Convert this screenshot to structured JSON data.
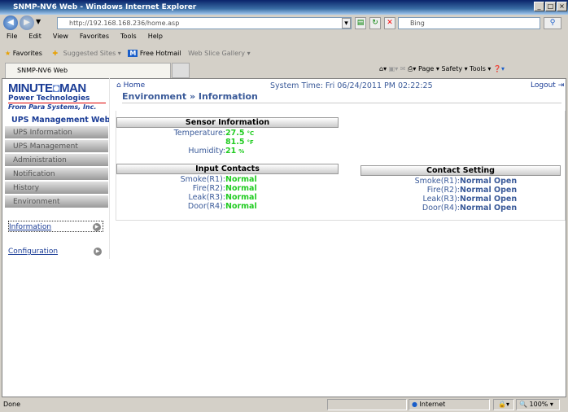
{
  "window": {
    "title": "SNMP-NV6 Web - Windows Internet Explorer"
  },
  "browser": {
    "address": "http://192.168.168.236/home.asp",
    "search_placeholder": "Bing",
    "menu": [
      "File",
      "Edit",
      "View",
      "Favorites",
      "Tools",
      "Help"
    ],
    "favorites_label": "Favorites",
    "fav_links": [
      "Suggested Sites ▾",
      "Free Hotmail",
      "Web Slice Gallery ▾"
    ],
    "tab_title": "SNMP-NV6 Web",
    "commands": [
      "Page ▾",
      "Safety ▾",
      "Tools ▾"
    ],
    "status": "Done",
    "zone": "Internet",
    "zoom": "100%"
  },
  "sidebar": {
    "logo": {
      "line1": "MINUTEMAN",
      "line2": "Power Technologies",
      "line3": "From Para Systems, Inc."
    },
    "title": "UPS Management Web",
    "items": [
      "UPS Information",
      "UPS Management",
      "Administration",
      "Notification",
      "History",
      "Environment"
    ],
    "subitems": [
      "Information",
      "Configuration"
    ]
  },
  "header": {
    "home": "Home",
    "system_time": "System Time: Fri 06/24/2011 PM 02:22:25",
    "logout": "Logout"
  },
  "page": {
    "title": "Environment » Information",
    "sensor": {
      "heading": "Sensor Information",
      "temp_label": "Temperature:",
      "temp_c": "27.5",
      "unit_c": "°C",
      "temp_f": "81.5",
      "unit_f": "°F",
      "hum_label": "Humidity:",
      "hum": "21",
      "unit_h": "%"
    },
    "input_contacts": {
      "heading": "Input Contacts",
      "rows": [
        {
          "label": "Smoke(R1):",
          "value": "Normal"
        },
        {
          "label": "Fire(R2):",
          "value": "Normal"
        },
        {
          "label": "Leak(R3):",
          "value": "Normal"
        },
        {
          "label": "Door(R4):",
          "value": "Normal"
        }
      ]
    },
    "contact_setting": {
      "heading": "Contact Setting",
      "rows": [
        {
          "label": "Smoke(R1):",
          "value": "Normal Open"
        },
        {
          "label": "Fire(R2):",
          "value": "Normal Open"
        },
        {
          "label": "Leak(R3):",
          "value": "Normal Open"
        },
        {
          "label": "Door(R4):",
          "value": "Normal Open"
        }
      ]
    }
  }
}
